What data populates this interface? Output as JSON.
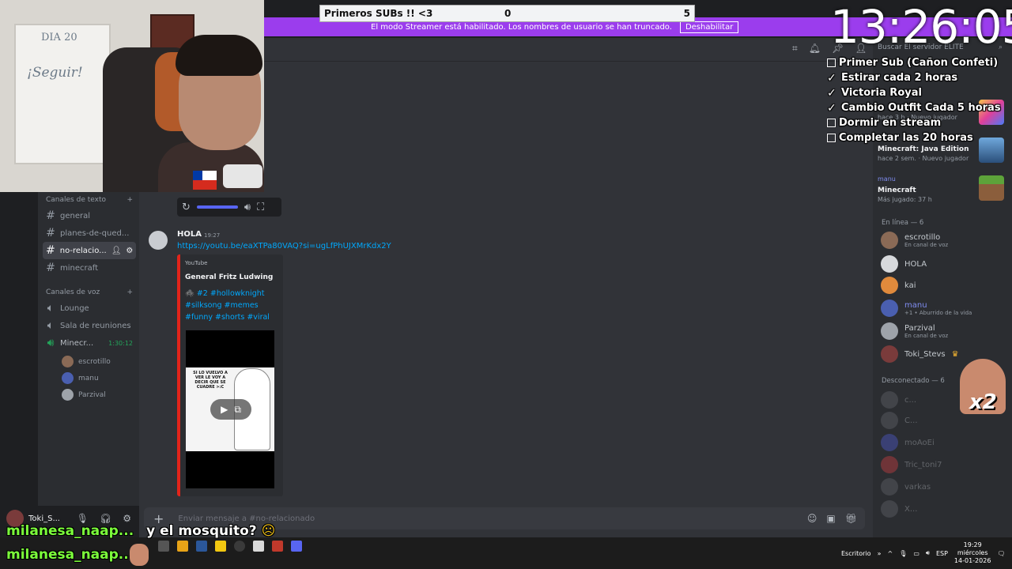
{
  "overlay": {
    "subs_goal": {
      "title": "Primeros SUBs !! <3",
      "current": "0",
      "target": "5"
    },
    "streamer_banner": {
      "text": "El modo Streamer está habilitado. Los nombres de usuario se han truncado.",
      "button": "Deshabilitar"
    },
    "clock": "13:26:05",
    "checklist": [
      {
        "label": "Primer Sub (Cañon Confeti)",
        "done": false
      },
      {
        "label": "Estirar cada 2 horas",
        "done": true
      },
      {
        "label": "Victoria Royal",
        "done": true
      },
      {
        "label": "Cambio Outfit Cada 5 horas",
        "done": true
      },
      {
        "label": "Dormir en stream",
        "done": false
      },
      {
        "label": "Completar las 20 horas",
        "done": false
      }
    ],
    "webcam_board": {
      "line1": "DIA 20",
      "line2": "¡Seguir!"
    },
    "chat": [
      {
        "user": "milanesa_naap...",
        "message": "y el mosquito?"
      },
      {
        "user": "milanesa_naap...",
        "message": ""
      }
    ],
    "multiplier": "x2"
  },
  "header": {
    "search_placeholder": "Buscar El servidor ELITE"
  },
  "channels": {
    "text_category": "Canales de texto",
    "text": [
      {
        "name": "general",
        "active": false
      },
      {
        "name": "planes-de-qued...",
        "active": false
      },
      {
        "name": "no-relacio...",
        "active": true
      },
      {
        "name": "minecraft",
        "active": false
      }
    ],
    "voice_category": "Canales de voz",
    "voice": [
      {
        "name": "Lounge"
      },
      {
        "name": "Sala de reuniones"
      },
      {
        "name": "Minecr...",
        "timer": "1:30:12"
      }
    ],
    "voice_users": [
      "escrotillo",
      "manu",
      "Parzival"
    ]
  },
  "message": {
    "author": "HOLA",
    "time": "19:27",
    "link": "https://youtu.be/eaXTPa80VAQ?si=ugLfPhUJXMrKdx2Y",
    "embed": {
      "provider": "YouTube",
      "title": "General Fritz Ludwing",
      "description": "🕷️ #2 #hollowknight #silksong #memes #funny #shorts #viral",
      "thumb_text": "SI LO VUELVO A VER LE VOY A DECIR QUE SE CUADRE >:C"
    }
  },
  "composer": {
    "placeholder": "Enviar mensaje a #no-relacionado"
  },
  "user_panel": {
    "name": "Toki_S..."
  },
  "members": {
    "activities": [
      {
        "meta": "hace 3 h",
        "tag": "Nuevo jugador"
      },
      {
        "title": "Minecraft: Java Edition",
        "meta": "hace 2 sem.",
        "tag": "Nuevo jugador"
      },
      {
        "user": "manu",
        "title": "Minecraft",
        "meta": "Más jugado: 37 h"
      }
    ],
    "online_header": "En línea — 6",
    "online": [
      {
        "name": "escrotillo",
        "status": "En canal de voz"
      },
      {
        "name": "HOLA",
        "status": ""
      },
      {
        "name": "kai",
        "status": ""
      },
      {
        "name": "manu",
        "status": "+1 • Aburrido de la vida"
      },
      {
        "name": "Parzival",
        "status": "En canal de voz"
      },
      {
        "name": "Toki_Stevs",
        "status": ""
      }
    ],
    "offline_header": "Desconectado — 6",
    "offline": [
      "c...",
      "C...",
      "moAoEi",
      "Tric_toni7",
      "varkas",
      "X..."
    ]
  },
  "taskbar": {
    "desktop_label": "Escritorio",
    "lang": "ESP",
    "time": "19:29",
    "day": "miércoles",
    "date": "14-01-2026"
  }
}
